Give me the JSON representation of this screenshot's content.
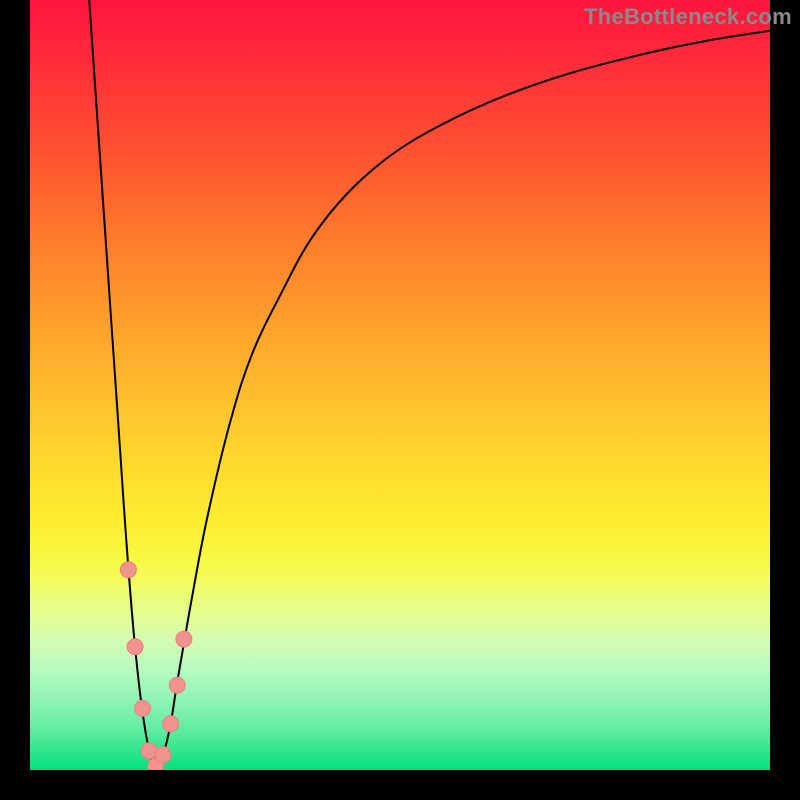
{
  "watermark": "TheBottleneck.com",
  "colors": {
    "curve": "#000000",
    "marker_fill": "#f39390",
    "marker_stroke": "#e97f7b",
    "background_black": "#000000"
  },
  "chart_data": {
    "type": "line",
    "title": "",
    "xlabel": "",
    "ylabel": "",
    "xlim": [
      0,
      100
    ],
    "ylim": [
      0,
      100
    ],
    "axes_visible": false,
    "series": [
      {
        "name": "bottleneck-curve",
        "x": [
          8,
          9,
          10,
          11,
          12,
          13,
          14,
          15,
          16,
          17,
          18,
          19,
          20,
          22,
          24,
          27,
          30,
          34,
          38,
          43,
          49,
          56,
          64,
          73,
          83,
          92,
          100
        ],
        "y": [
          100,
          86,
          72,
          58,
          44,
          30,
          18,
          9,
          3,
          0,
          2,
          6,
          12,
          23,
          33,
          45,
          54,
          62,
          69,
          75,
          80,
          84,
          87.5,
          90.5,
          93,
          94.8,
          96
        ]
      }
    ],
    "markers": {
      "name": "highlighted-points",
      "x": [
        13.3,
        14.2,
        15.2,
        16.1,
        17.0,
        18.0,
        19.0,
        19.9,
        20.8
      ],
      "y": [
        26,
        16,
        8,
        2.5,
        0.5,
        2,
        6,
        11,
        17
      ],
      "radius": 8
    },
    "background_gradient": {
      "top": "#ff153f",
      "mid": "#ffe22f",
      "bottom": "#05e07e"
    }
  }
}
